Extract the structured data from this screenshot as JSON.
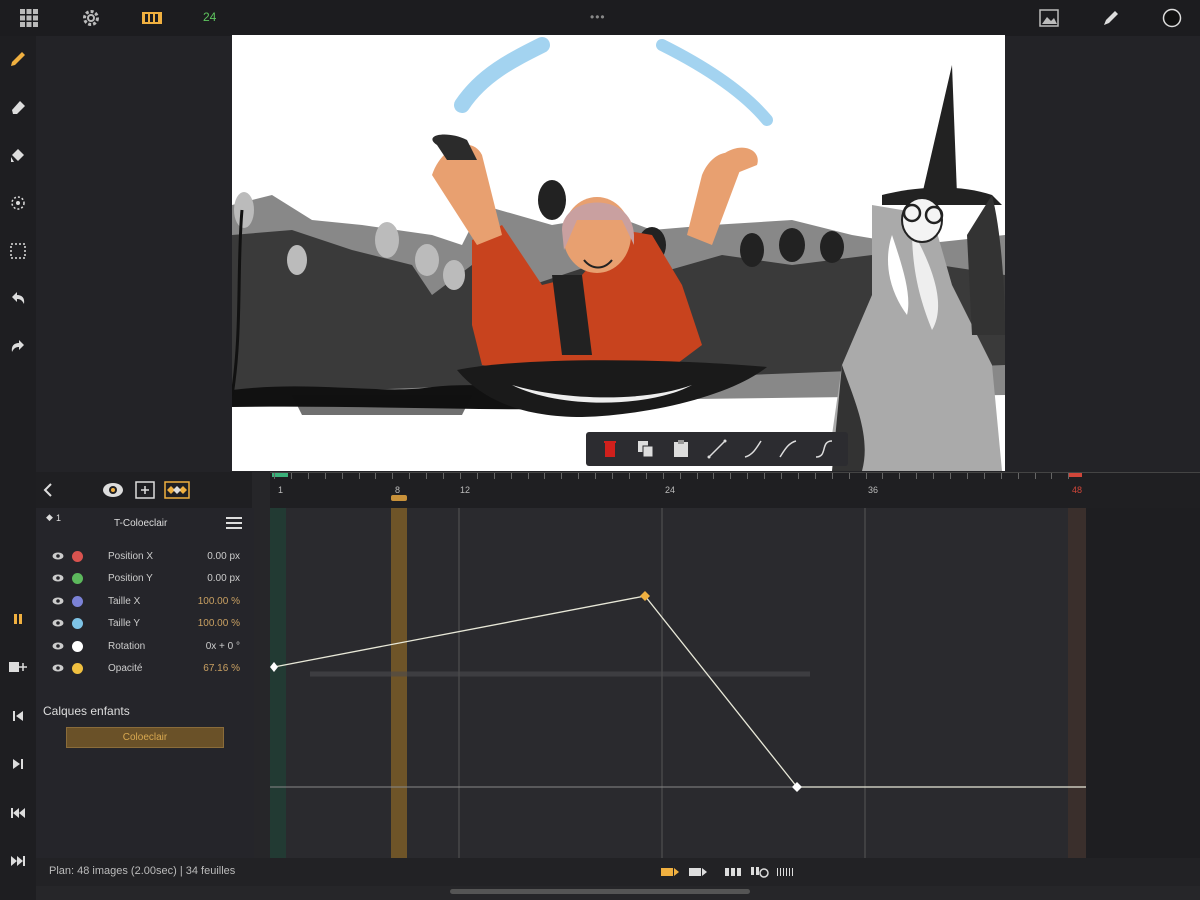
{
  "topbar": {
    "fps": "24",
    "grip": "•••",
    "icons": [
      "grid-icon",
      "gear-icon",
      "film-strip-icon",
      "image-icon",
      "pen-icon",
      "color-circle-icon"
    ]
  },
  "left_tools": [
    "pencil-icon",
    "eraser-icon",
    "fill-icon",
    "brush-settings-icon",
    "selection-icon",
    "undo-icon",
    "redo-icon"
  ],
  "floating_toolbar": [
    "delete-icon",
    "copy-icon",
    "paste-icon",
    "ease-linear-icon",
    "ease-in-icon",
    "ease-out-icon",
    "ease-in-out-icon"
  ],
  "timeline": {
    "layer_index": "1",
    "layer_name": "T-Coloeclair",
    "ruler_labels": [
      "1",
      "8",
      "12",
      "24",
      "36",
      "48"
    ],
    "current_frame": "8",
    "properties": [
      {
        "name": "Position X",
        "value": "0.00",
        "unit": "px",
        "color": "#d9534f"
      },
      {
        "name": "Position Y",
        "value": "0.00",
        "unit": "px",
        "color": "#5cb85c"
      },
      {
        "name": "Taille X",
        "value": "100.00",
        "unit": "%",
        "color": "#7b82d6"
      },
      {
        "name": "Taille Y",
        "value": "100.00",
        "unit": "%",
        "color": "#7ec3e6"
      },
      {
        "name": "Rotation",
        "value": "0x +",
        "unit": "0 °",
        "color": "#ffffff"
      },
      {
        "name": "Opacité",
        "value": "67.16",
        "unit": "%",
        "color": "#f0c040"
      }
    ],
    "children_title": "Calques enfants",
    "child_layer": "Coloeclair",
    "status": "Plan: 48 images (2.00sec) | 34 feuilles"
  },
  "colors": {
    "accent": "#f0b040",
    "playhead": "#8a6a30",
    "curve": "#e8e8d8"
  }
}
